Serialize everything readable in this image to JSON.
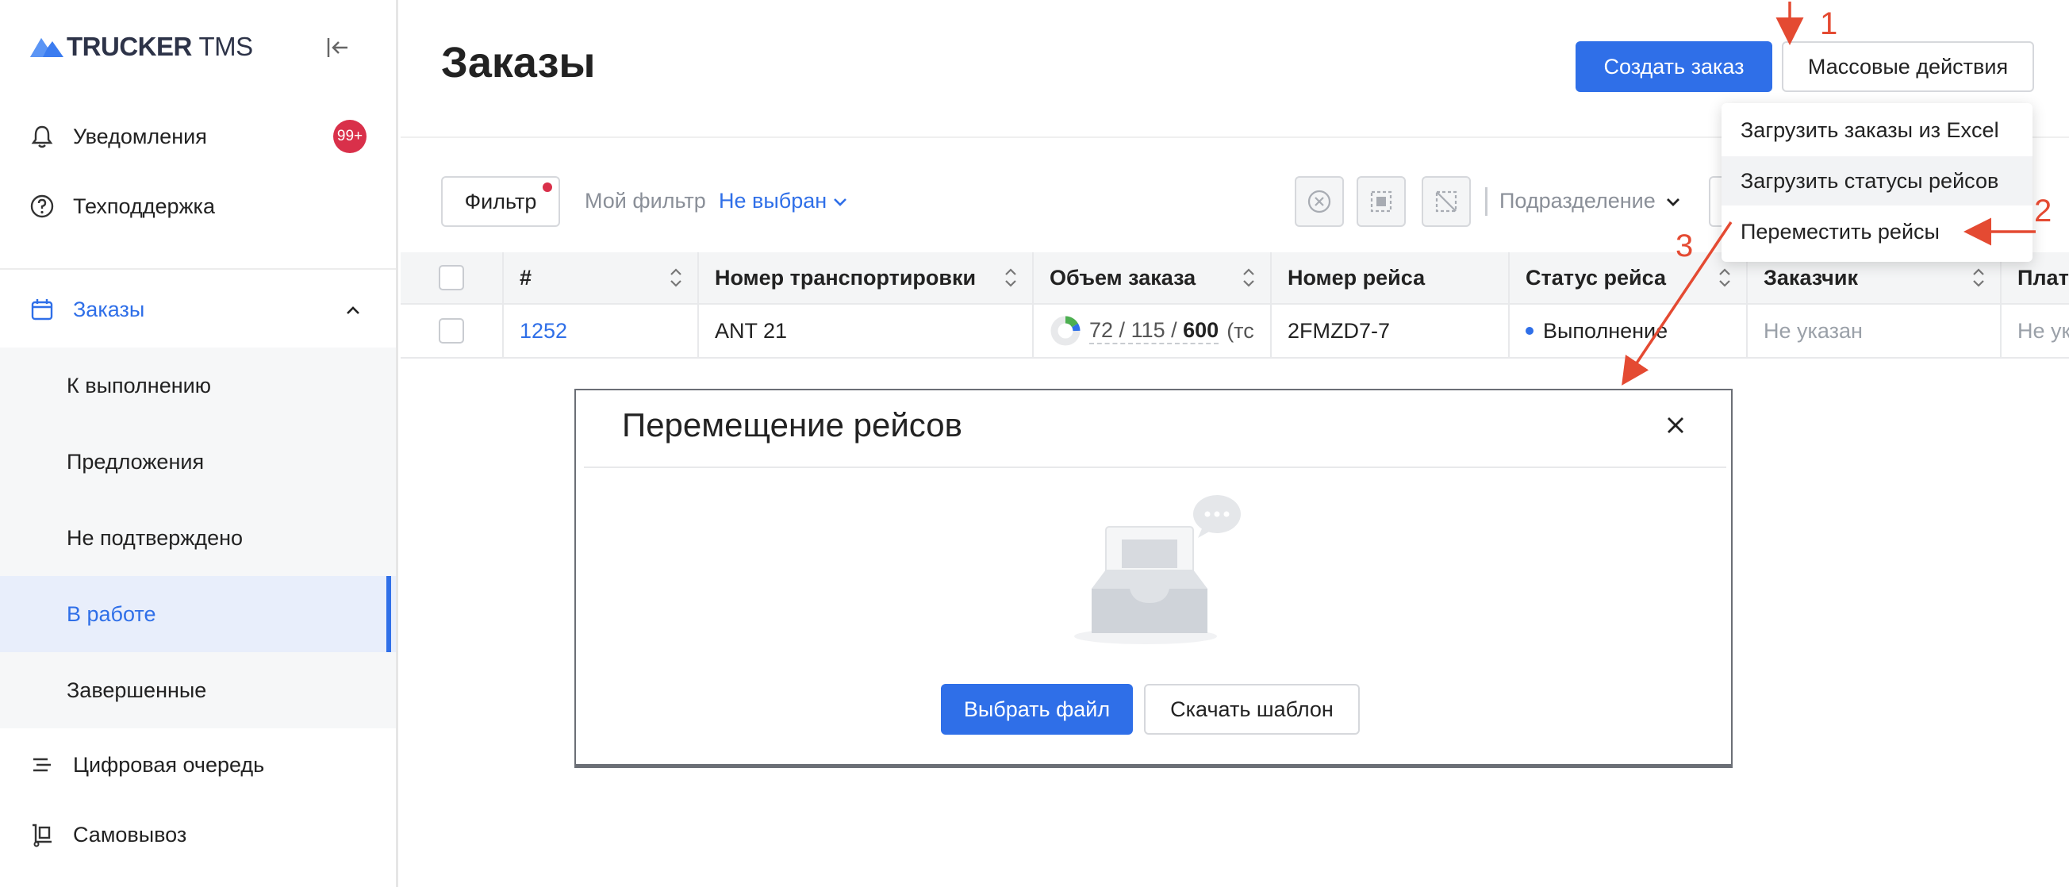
{
  "app": {
    "logo_main": "TRUCKER",
    "logo_sub": "TMS"
  },
  "sidebar": {
    "notifications": {
      "label": "Уведомления",
      "badge": "99+"
    },
    "support": {
      "label": "Техподдержка"
    },
    "orders": {
      "label": "Заказы"
    },
    "sub_items": [
      {
        "label": "К выполнению"
      },
      {
        "label": "Предложения"
      },
      {
        "label": "Не подтверждено"
      },
      {
        "label": "В работе"
      },
      {
        "label": "Завершенные"
      }
    ],
    "digital_queue": {
      "label": "Цифровая очередь"
    },
    "pickup": {
      "label": "Самовывоз"
    }
  },
  "header": {
    "title": "Заказы",
    "create_label": "Создать заказ",
    "mass_label": "Массовые действия"
  },
  "toolbar": {
    "filter_label": "Фильтр",
    "my_filter_label": "Мой фильтр",
    "my_filter_value": "Не выбран",
    "subdivision_label": "Подразделение"
  },
  "dropdown": {
    "items": [
      {
        "label": "Загрузить заказы из Excel"
      },
      {
        "label": "Загрузить статусы рейсов"
      },
      {
        "label": "Переместить рейсы"
      }
    ]
  },
  "table": {
    "columns": [
      "#",
      "Номер транспортировки",
      "Объем заказа",
      "Номер рейса",
      "Статус рейса",
      "Заказчик",
      "Плате"
    ],
    "row": {
      "id": "1252",
      "transport": "ANT 21",
      "vol_a": "72",
      "vol_b": "115",
      "vol_c": "600",
      "vol_unit": "(тс",
      "trip": "2FMZD7-7",
      "status": "Выполнение",
      "customer": "Не указан",
      "payer": "Не ук"
    }
  },
  "modal": {
    "title": "Перемещение рейсов",
    "choose_label": "Выбрать файл",
    "template_label": "Скачать шаблон"
  },
  "annotations": {
    "n1": "1",
    "n2": "2",
    "n3": "3"
  },
  "colors": {
    "accent": "#2f6fe8",
    "badge": "#d9304a",
    "annotation": "#e44a32"
  }
}
